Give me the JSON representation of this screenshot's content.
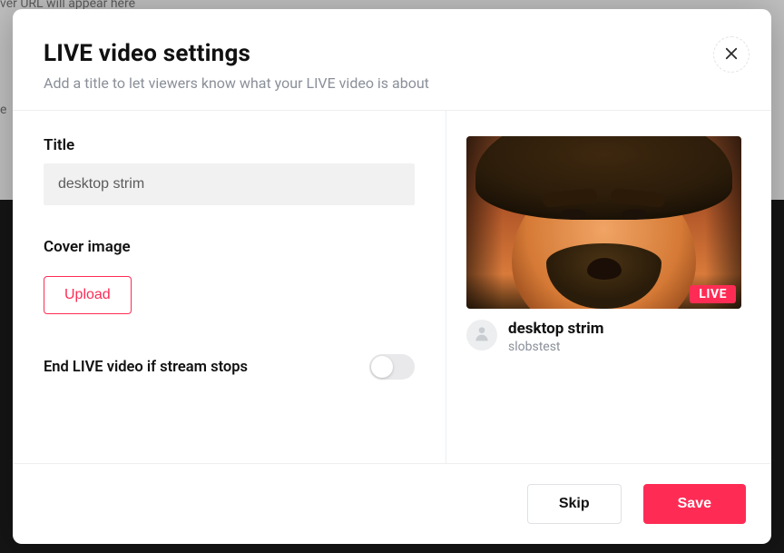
{
  "background": {
    "placeholder_line": "ver URL will appear here",
    "stray": "e"
  },
  "modal": {
    "title": "LIVE video settings",
    "subtitle": "Add a title to let viewers know what your LIVE video is about",
    "close_label": "Close"
  },
  "form": {
    "title_label": "Title",
    "title_value": "desktop strim",
    "cover_label": "Cover image",
    "upload_label": "Upload",
    "end_stream_label": "End LIVE video if stream stops",
    "end_stream_enabled": false
  },
  "preview": {
    "live_badge": "LIVE",
    "title": "desktop strim",
    "username": "slobstest"
  },
  "footer": {
    "skip_label": "Skip",
    "save_label": "Save"
  },
  "colors": {
    "accent": "#fe2c55"
  }
}
